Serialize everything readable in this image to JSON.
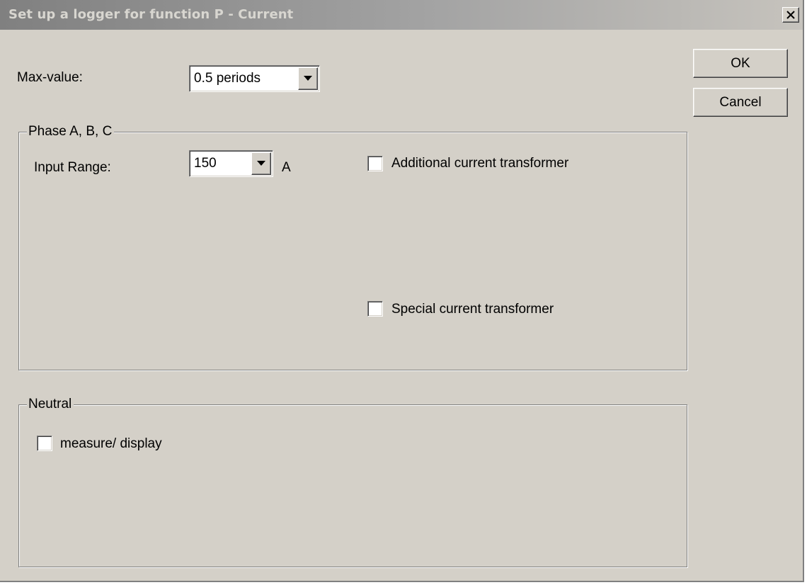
{
  "window": {
    "title": "Set up a logger for function P - Current",
    "close_symbol": "x"
  },
  "buttons": {
    "ok": "OK",
    "cancel": "Cancel"
  },
  "max_value": {
    "label": "Max-value:",
    "selected": "0.5 periods"
  },
  "phase_group": {
    "title": "Phase A, B, C",
    "input_range_label": "Input Range:",
    "input_range_value": "150",
    "unit": "A",
    "additional_ct_label": "Additional current transformer",
    "additional_ct_checked": false,
    "special_ct_label": "Special current transformer",
    "special_ct_checked": false
  },
  "neutral_group": {
    "title": "Neutral",
    "measure_display_label": "measure/ display",
    "measure_display_checked": false
  },
  "colors": {
    "dialog_bg": "#d4d0c8",
    "title_gradient_start": "#808080",
    "title_gradient_end": "#c6c3bd",
    "title_text": "#d8d6d0"
  }
}
